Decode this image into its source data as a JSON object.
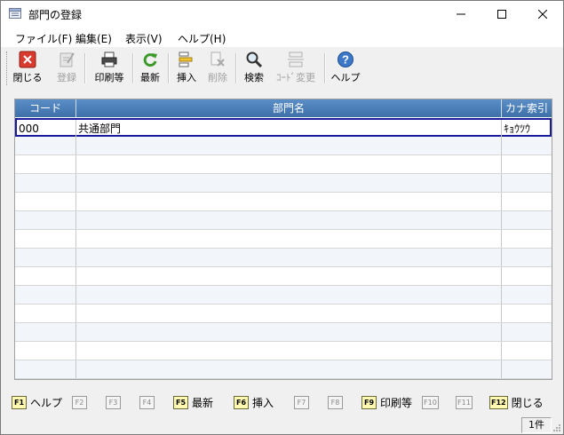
{
  "window": {
    "title": "部門の登録"
  },
  "menu": [
    {
      "label": "ファイル(F)"
    },
    {
      "label": "編集(E)"
    },
    {
      "label": "表示(V)"
    },
    {
      "label": "ヘルプ(H)"
    }
  ],
  "toolbar": {
    "close": {
      "label": "閉じる",
      "icon": "close-icon"
    },
    "register": {
      "label": "登録",
      "icon": "register-icon",
      "enabled": false
    },
    "print": {
      "label": "印刷等",
      "icon": "printer-icon"
    },
    "refresh": {
      "label": "最新",
      "icon": "refresh-icon"
    },
    "insert": {
      "label": "挿入",
      "icon": "insert-row-icon"
    },
    "delete": {
      "label": "削除",
      "icon": "delete-row-icon",
      "enabled": false
    },
    "search": {
      "label": "検索",
      "icon": "magnifier-icon"
    },
    "code_change": {
      "label": "ｺｰﾄﾞ変更",
      "icon": "code-change-icon",
      "enabled": false
    },
    "help": {
      "label": "ヘルプ",
      "icon": "help-icon"
    }
  },
  "grid": {
    "columns": [
      "コード",
      "部門名",
      "カナ索引"
    ],
    "rows": [
      {
        "code": "000",
        "name": "共通部門",
        "kana": "ｷｮｳﾂｳ"
      }
    ]
  },
  "fkeys": [
    {
      "key": "F1",
      "label": "ヘルプ",
      "active": true
    },
    {
      "key": "F2",
      "label": "",
      "active": false
    },
    {
      "key": "F3",
      "label": "",
      "active": false
    },
    {
      "key": "F4",
      "label": "",
      "active": false
    },
    {
      "key": "F5",
      "label": "最新",
      "active": true
    },
    {
      "key": "F6",
      "label": "挿入",
      "active": true
    },
    {
      "key": "F7",
      "label": "",
      "active": false
    },
    {
      "key": "F8",
      "label": "",
      "active": false
    },
    {
      "key": "F9",
      "label": "印刷等",
      "active": true
    },
    {
      "key": "F10",
      "label": "",
      "active": false
    },
    {
      "key": "F11",
      "label": "",
      "active": false
    },
    {
      "key": "F12",
      "label": "閉じる",
      "active": true
    }
  ],
  "status": {
    "count": "1件"
  }
}
